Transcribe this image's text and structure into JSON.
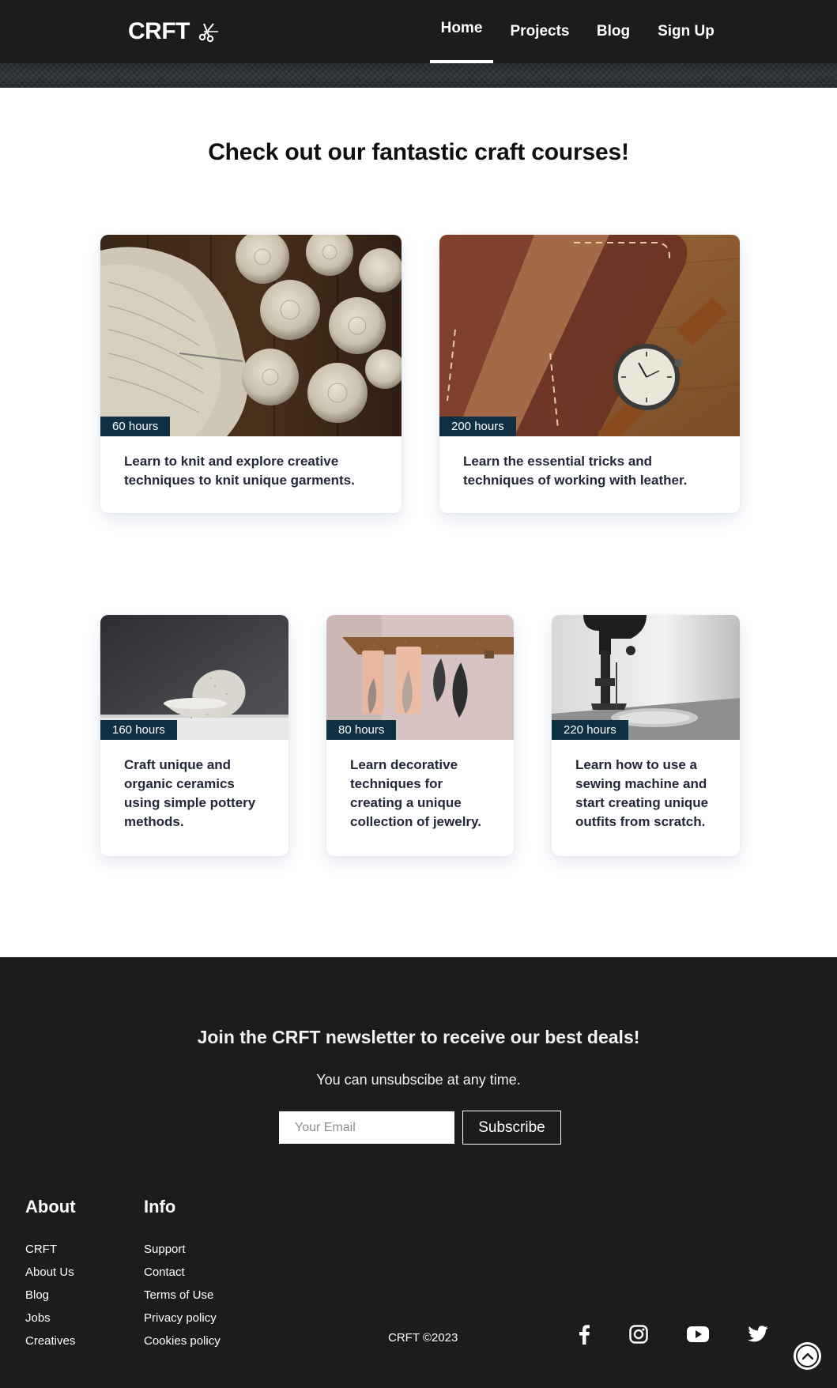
{
  "header": {
    "logo_text": "CRFT",
    "logo_icon": "scissors-icon",
    "nav": [
      {
        "label": "Home",
        "active": true
      },
      {
        "label": "Projects",
        "active": false
      },
      {
        "label": "Blog",
        "active": false
      },
      {
        "label": "Sign Up",
        "active": false
      }
    ]
  },
  "main": {
    "title": "Check out our fantastic craft courses!",
    "courses": [
      {
        "hours": "60 hours",
        "description": "Learn to knit and explore creative techniques to knit unique garments.",
        "image": "knitting-yarn-image"
      },
      {
        "hours": "200 hours",
        "description": "Learn the essential tricks and techniques of working with leather.",
        "image": "leather-wallet-watch-image"
      },
      {
        "hours": "160 hours",
        "description": "Craft unique and organic ceramics using simple pottery methods.",
        "image": "ceramic-bowls-image"
      },
      {
        "hours": "80 hours",
        "description": "Learn decorative techniques for creating a unique collection of jewelry.",
        "image": "leather-earrings-image"
      },
      {
        "hours": "220 hours",
        "description": "Learn how to use a sewing machine and start creating unique outfits from scratch.",
        "image": "sewing-machine-image"
      }
    ]
  },
  "footer": {
    "newsletter_title": "Join the CRFT newsletter to receive our best deals!",
    "newsletter_subtitle": "You can unsubscibe at any time.",
    "email_placeholder": "Your Email",
    "subscribe_label": "Subscribe",
    "about": {
      "title": "About",
      "links": [
        "CRFT",
        "About Us",
        "Blog",
        "Jobs",
        "Creatives"
      ]
    },
    "info": {
      "title": "Info",
      "links": [
        "Support",
        "Contact",
        "Terms of Use",
        "Privacy policy",
        "Cookies policy"
      ]
    },
    "copyright": "CRFT ©2023",
    "social": [
      "facebook-icon",
      "instagram-icon",
      "youtube-icon",
      "twitter-icon"
    ],
    "back_to_top": "chevron-up-icon"
  },
  "colors": {
    "header_bg": "#1d1b1c",
    "badge_bg": "#0f2f43",
    "card_text": "#222838"
  }
}
